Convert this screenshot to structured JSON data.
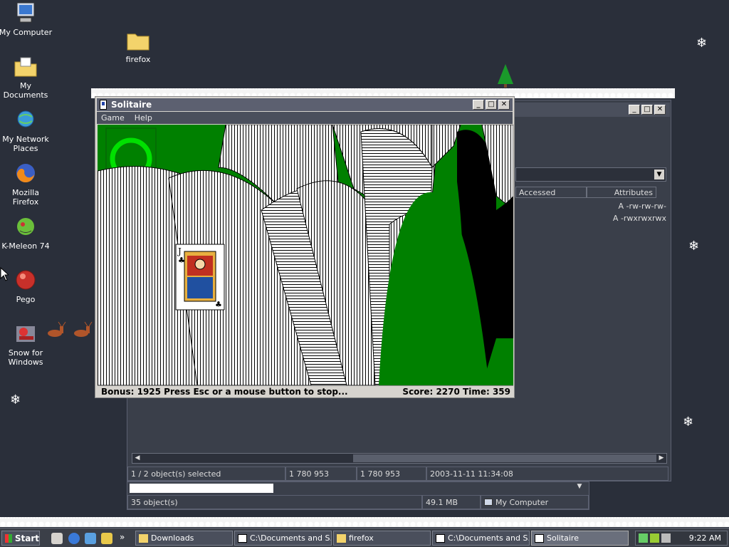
{
  "desktop": {
    "icons": [
      {
        "label": "My Computer",
        "icon": "computer-icon"
      },
      {
        "label": "firefox",
        "icon": "folder-icon"
      },
      {
        "label": "My Documents",
        "icon": "documents-folder-icon"
      },
      {
        "label": "My Network Places",
        "icon": "network-icon"
      },
      {
        "label": "Mozilla Firefox",
        "icon": "firefox-icon"
      },
      {
        "label": "K-Meleon 74",
        "icon": "kmeleon-icon"
      },
      {
        "label": "Pego",
        "icon": "pego-icon"
      },
      {
        "label": "Snow for Windows",
        "icon": "snow-santa-icon"
      }
    ]
  },
  "explorer": {
    "columns": [
      "Accessed",
      "Attributes"
    ],
    "rows": [
      {
        "attributes": "A -rw-rw-rw-"
      },
      {
        "attributes": "A -rwxrwxrwx"
      }
    ],
    "status": {
      "selected": "1 / 2 object(s) selected",
      "size1": "1 780 953",
      "size2": "1 780 953",
      "modified": "2003-11-11 11:34:08"
    }
  },
  "folder_window": {
    "status": {
      "count": "35 object(s)",
      "size": "49.1 MB",
      "location": "My Computer"
    }
  },
  "solitaire": {
    "title": "Solitaire",
    "menu": [
      "Game",
      "Help"
    ],
    "status_left": "Bonus: 1925  Press Esc or a mouse button to stop...",
    "status_right": "Score: 2270 Time: 359",
    "felt_color": "#008000"
  },
  "taskbar": {
    "start_label": "Start",
    "tasks": [
      {
        "label": "Downloads",
        "icon": "folder-icon"
      },
      {
        "label": "C:\\Documents and S...",
        "icon": "7zip-icon"
      },
      {
        "label": "firefox",
        "icon": "folder-icon"
      },
      {
        "label": "C:\\Documents and S...",
        "icon": "7zip-icon"
      },
      {
        "label": "Solitaire",
        "icon": "solitaire-icon",
        "active": true
      }
    ],
    "clock": "9:22 AM",
    "overflow_label": "»"
  }
}
